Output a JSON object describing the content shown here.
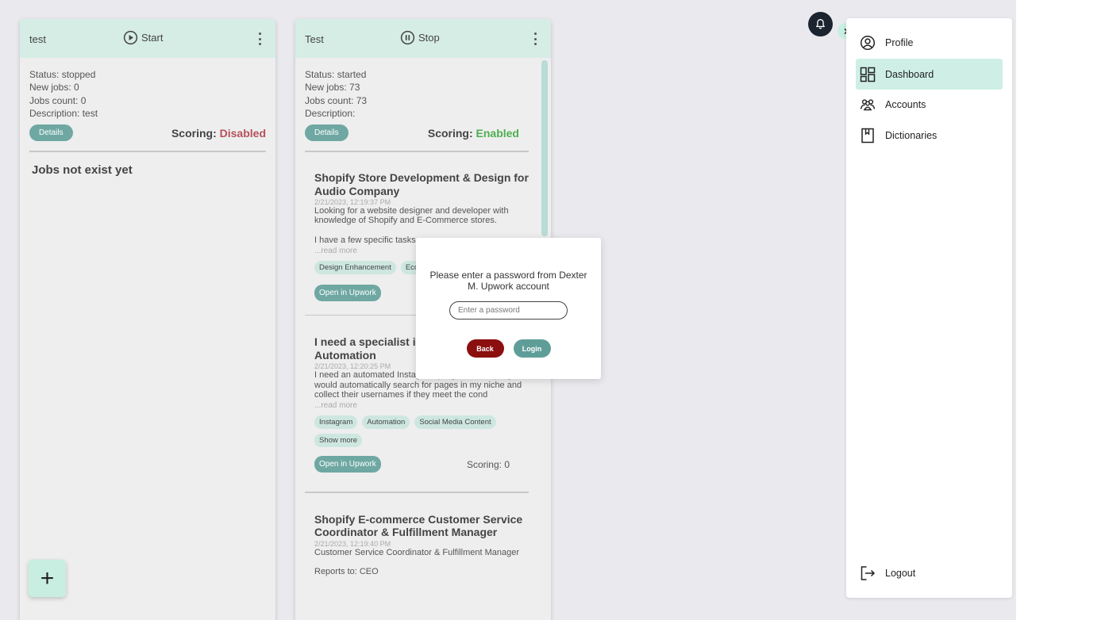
{
  "columns": [
    {
      "name": "test",
      "control_label": "Start",
      "status": "Status: stopped",
      "new_jobs": "New jobs: 0",
      "jobs_count": "Jobs count: 0",
      "description": "Description: test",
      "details_label": "Details",
      "scoring_label": "Scoring:",
      "scoring_value": "Disabled",
      "empty_text": "Jobs not exist yet"
    },
    {
      "name": "Test",
      "control_label": "Stop",
      "status": "Status: started",
      "new_jobs": "New jobs: 73",
      "jobs_count": "Jobs count: 73",
      "description": "Description:",
      "details_label": "Details",
      "scoring_label": "Scoring:",
      "scoring_value": "Enabled"
    }
  ],
  "jobs": [
    {
      "title": "Shopify Store Development & Design for Audio Company",
      "date": "2/21/2023, 12:19:37 PM",
      "description": "Looking for a website designer and developer with knowledge of Shopify and E-Commerce stores.",
      "description_extra": "I have a few specific tasks",
      "read_more": "...read more",
      "tags": [
        "Design Enhancement",
        "Ecommerce"
      ],
      "open_label": "Open in Upwork"
    },
    {
      "title": "I need a specialist in Instagram Automation",
      "date": "2/21/2023, 12:20:25 PM",
      "description": "I need an automated Instagram program. This program would automatically search for pages in my niche and collect their usernames if they meet the cond",
      "read_more": "...read more",
      "tags": [
        "Instagram",
        "Automation",
        "Social Media Content"
      ],
      "show_more": "Show more",
      "open_label": "Open in Upwork",
      "score": "Scoring: 0"
    },
    {
      "title": "Shopify E-commerce Customer Service Coordinator & Fulfillment Manager",
      "date": "2/21/2023, 12:19:40 PM",
      "description": "Customer Service Coordinator & Fulfillment Manager",
      "description_extra": "Reports to: CEO"
    }
  ],
  "fab": {
    "label": "+"
  },
  "modal": {
    "message": "Please enter a password from Dexter M. Upwork account",
    "placeholder": "Enter a password",
    "back_label": "Back",
    "login_label": "Login"
  },
  "sidebar": {
    "items": [
      {
        "label": "Profile",
        "icon": "profile-icon"
      },
      {
        "label": "Dashboard",
        "icon": "dashboard-icon",
        "active": true
      },
      {
        "label": "Accounts",
        "icon": "accounts-icon"
      },
      {
        "label": "Dictionaries",
        "icon": "dictionary-icon"
      }
    ],
    "logout_label": "Logout"
  },
  "colors": {
    "accent": "#6fa8a3",
    "header_bg": "#d6ede6",
    "tag_bg": "#cde7e0",
    "disabled": "#b5505a",
    "enabled": "#4caf50",
    "back_button": "#8b0f0f",
    "active_nav": "#cfefe6"
  }
}
